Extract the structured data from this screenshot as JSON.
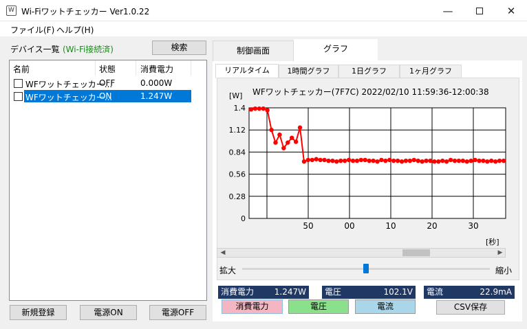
{
  "window": {
    "title": "Wi-Fiワットチェッカー Ver1.0.22",
    "icon_glyph": "W"
  },
  "menu": {
    "file": "ファイル(F)",
    "help": "ヘルプ(H)"
  },
  "device_panel": {
    "title": "デバイス一覧",
    "status": "(Wi-Fi接続済)",
    "search_label": "検索",
    "columns": [
      "名前",
      "状態",
      "消費電力"
    ],
    "rows": [
      {
        "name": "WFワットチェッカー...",
        "state": "OFF",
        "power": "0.000W",
        "selected": false
      },
      {
        "name": "WFワットチェッカー...",
        "state": "ON",
        "power": "1.247W",
        "selected": true
      }
    ],
    "register_label": "新規登録",
    "power_on_label": "電源ON",
    "power_off_label": "電源OFF"
  },
  "tabs": [
    "制御画面",
    "グラフ"
  ],
  "active_tab": "グラフ",
  "subtabs": [
    "リアルタイム",
    "1時間グラフ",
    "1日グラフ",
    "1ヶ月グラフ"
  ],
  "active_subtab": "リアルタイム",
  "graph": {
    "header": "WFワットチェッカー(7F7C)  2022/02/10  11:59:36-12:00:38",
    "y_unit": "[W]",
    "x_unit": "[秒]",
    "zoom_in_label": "拡大",
    "zoom_out_label": "縮小",
    "zoom_level": 0.5,
    "line_color": "#ff0000"
  },
  "chart_data": {
    "type": "line",
    "title": "WFワットチェッカー(7F7C)  2022/02/10  11:59:36-12:00:38",
    "ylabel": "[W]",
    "xlabel": "[秒]",
    "ylim": [
      0,
      1.4
    ],
    "yticks": [
      "1.4",
      "1.12",
      "0.84",
      "0.56",
      "0.28",
      "0"
    ],
    "xticks": [
      "50",
      "00",
      "10",
      "20",
      "30"
    ],
    "grid": true,
    "series": [
      {
        "values": [
          1.38,
          1.39,
          1.39,
          1.39,
          1.37,
          1.12,
          0.96,
          1.06,
          0.89,
          0.96,
          1.02,
          0.97,
          1.15,
          0.72,
          0.74,
          0.74,
          0.75,
          0.74,
          0.74,
          0.73,
          0.73,
          0.72,
          0.73,
          0.73,
          0.74,
          0.73,
          0.73,
          0.74,
          0.74,
          0.73,
          0.73,
          0.72,
          0.74,
          0.73,
          0.74,
          0.73,
          0.73,
          0.72,
          0.73,
          0.73,
          0.74,
          0.73,
          0.72,
          0.73,
          0.73,
          0.72,
          0.72,
          0.73,
          0.72,
          0.74,
          0.73,
          0.73,
          0.73,
          0.72,
          0.73,
          0.74,
          0.73,
          0.73,
          0.72,
          0.73,
          0.72,
          0.73,
          0.73
        ]
      }
    ]
  },
  "readouts": {
    "power_label": "消費電力",
    "power_value": "1.247W",
    "voltage_label": "電圧",
    "voltage_value": "102.1V",
    "current_label": "電流",
    "current_value": "22.9mA"
  },
  "legend": {
    "power": "消費電力",
    "voltage": "電圧",
    "current": "電流"
  },
  "csv_label": "CSV保存",
  "colors": {
    "selection": "#0078d7",
    "readout_bg": "#203864",
    "power_btn": "#f4b6c2",
    "voltage_btn": "#8be08b",
    "current_btn": "#a9d6e8"
  }
}
